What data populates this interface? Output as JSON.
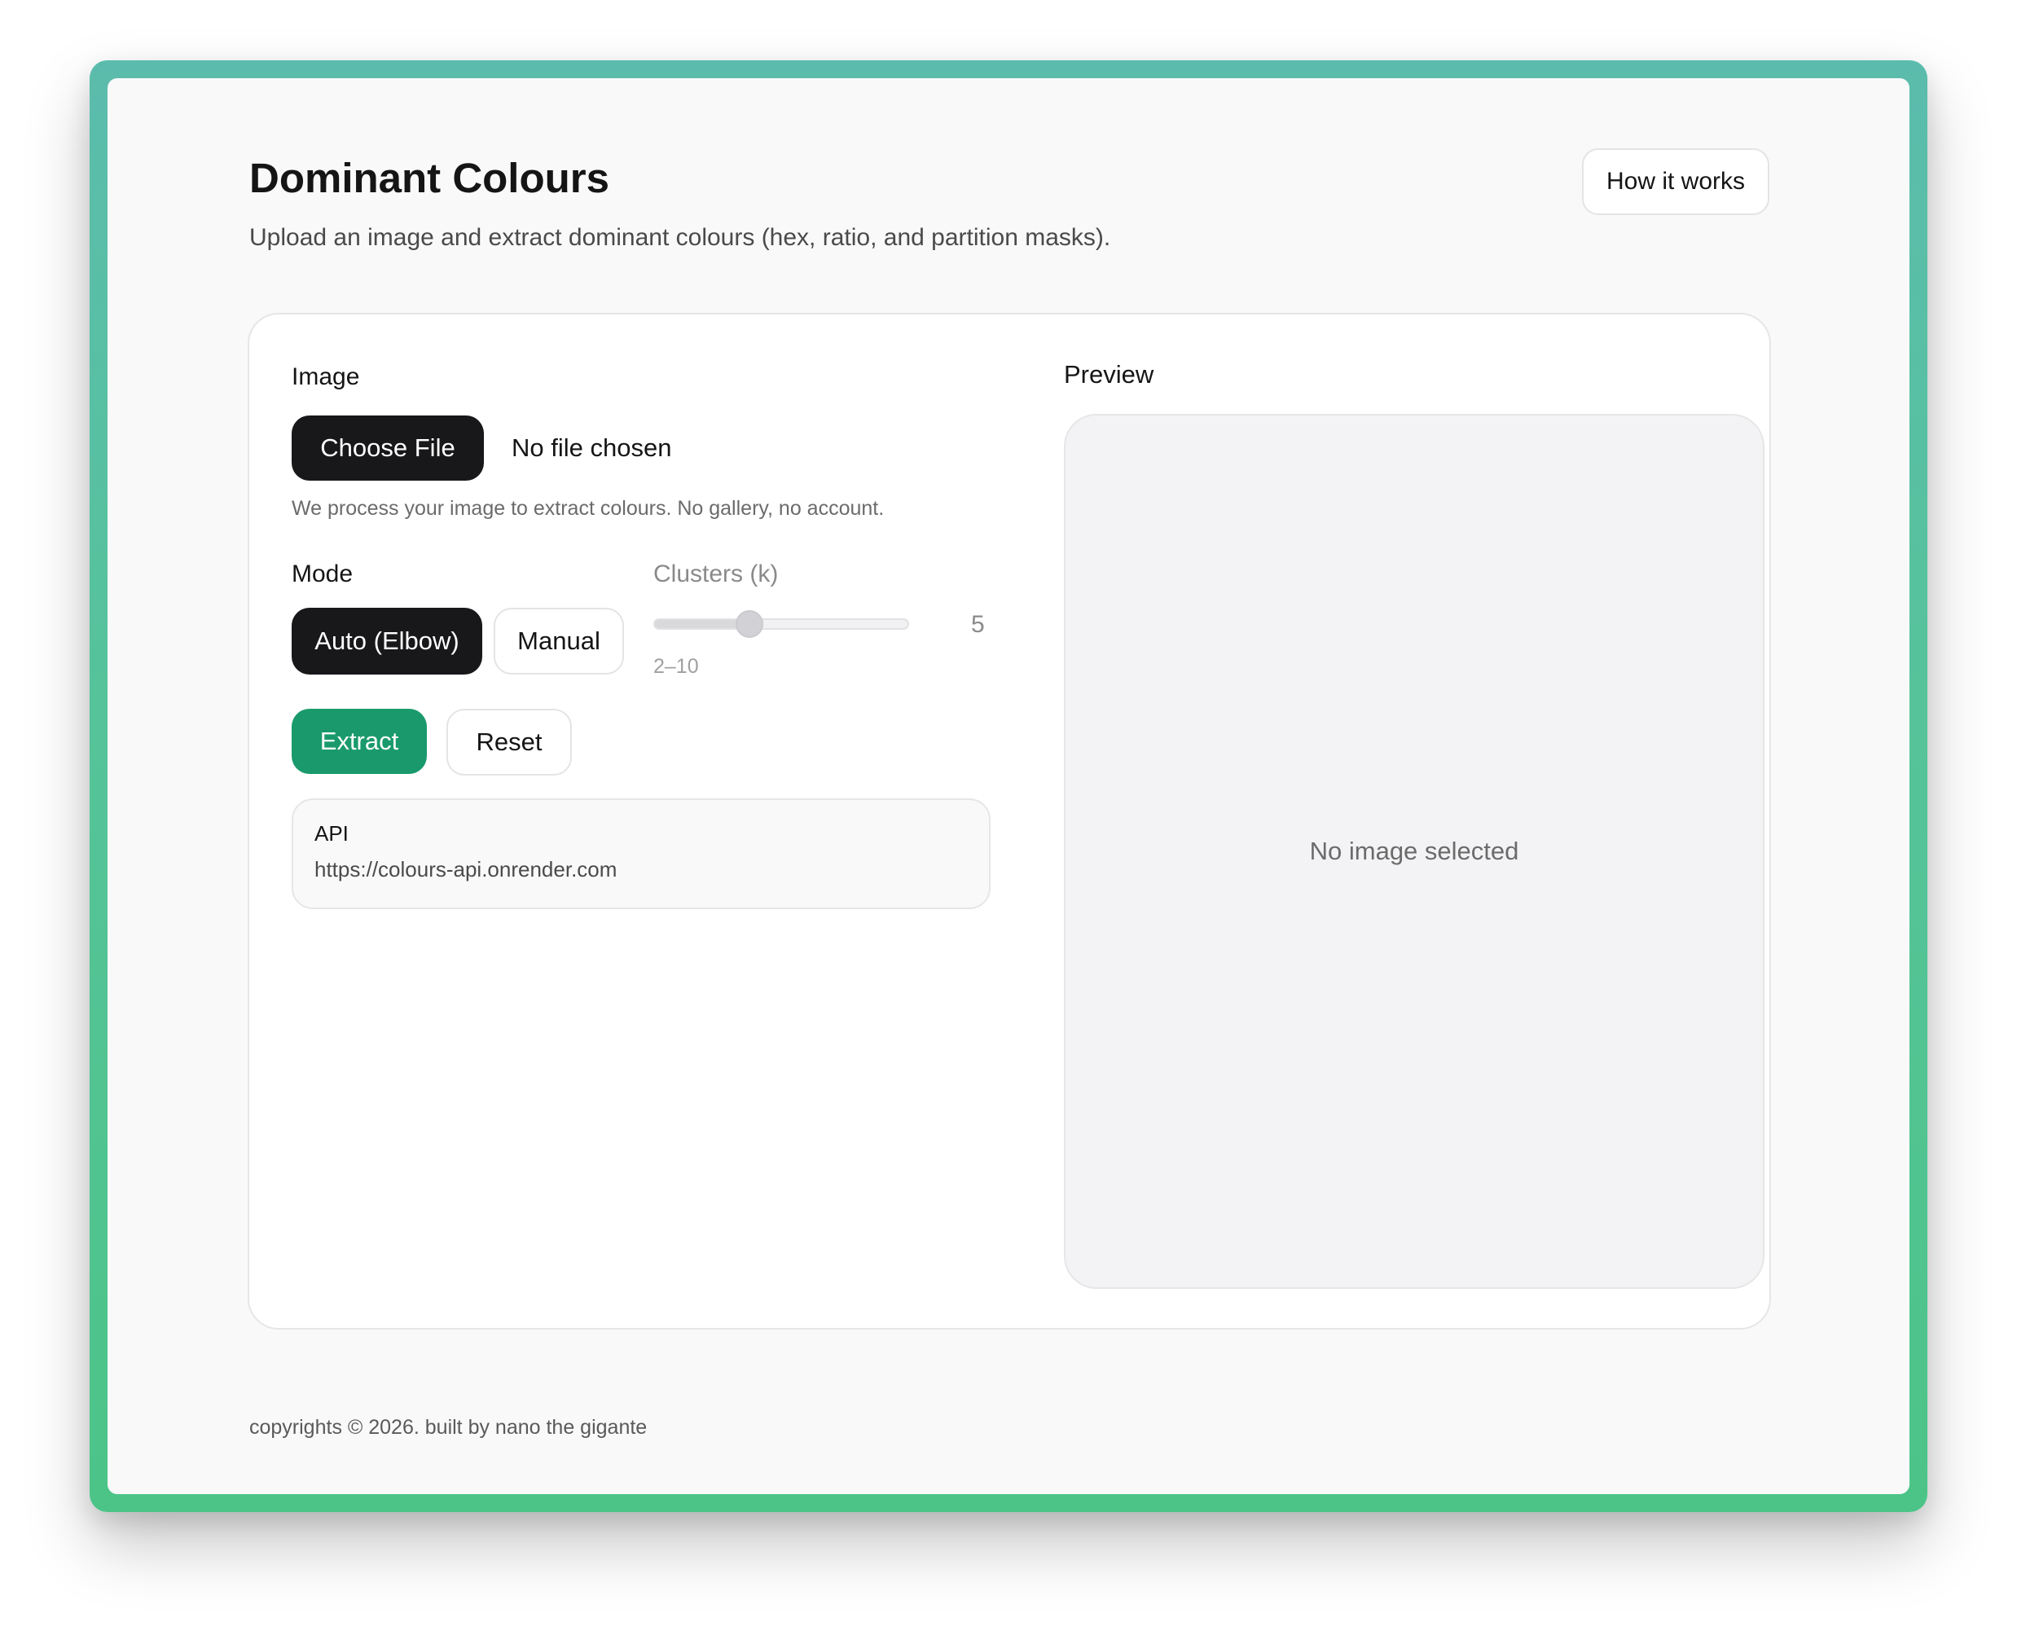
{
  "header": {
    "title": "Dominant Colours",
    "subtitle": "Upload an image and extract dominant colours (hex, ratio, and partition masks).",
    "how_it_works_label": "How it works"
  },
  "form": {
    "image_label": "Image",
    "choose_file_label": "Choose File",
    "file_status": "No file chosen",
    "helper_text": "We process your image to extract colours. No gallery, no account.",
    "mode_label": "Mode",
    "mode_options": [
      "Auto (Elbow)",
      "Manual"
    ],
    "mode_selected": "Auto (Elbow)",
    "clusters_label": "Clusters (k)",
    "clusters_value": "5",
    "clusters_range": "2–10",
    "clusters_min": 2,
    "clusters_max": 10,
    "clusters_disabled": true,
    "extract_label": "Extract",
    "reset_label": "Reset",
    "api_title": "API",
    "api_url": "https://colours-api.onrender.com"
  },
  "preview": {
    "label": "Preview",
    "empty_text": "No image selected"
  },
  "footer": {
    "text": "copyrights © 2026. built by nano the gigante"
  },
  "colors": {
    "accent_green": "#1a9a6c",
    "dark_button": "#18181b",
    "frame_gradient_top": "#5bbcad",
    "frame_gradient_bottom": "#4cc488"
  }
}
